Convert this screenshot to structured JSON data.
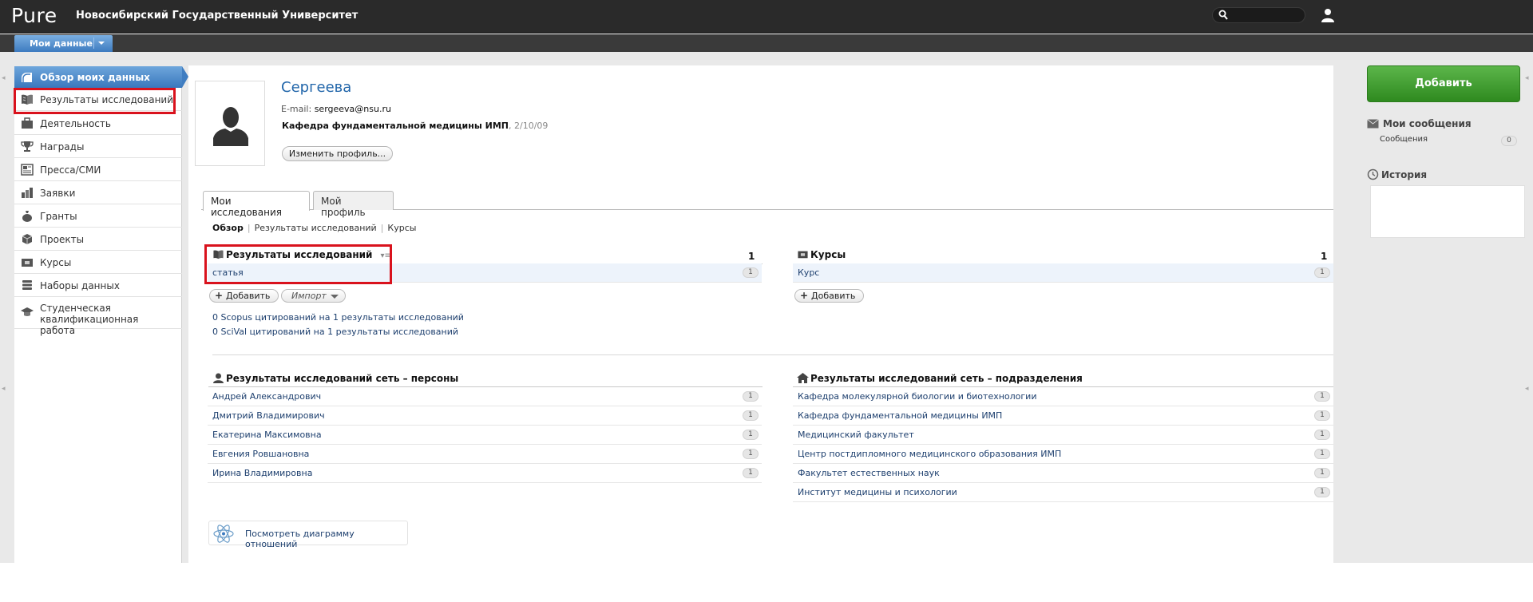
{
  "app": {
    "logo": "Pure",
    "university": "Новосибирский Государственный Университет",
    "search_placeholder": "",
    "nav_button": "Мои данные"
  },
  "sidebar": {
    "overview": "Обзор моих данных",
    "items": [
      {
        "label": "Результаты исследований",
        "icon": "book-icon"
      },
      {
        "label": "Деятельность",
        "icon": "briefcase-icon"
      },
      {
        "label": "Награды",
        "icon": "trophy-icon"
      },
      {
        "label": "Пресса/СМИ",
        "icon": "newspaper-icon"
      },
      {
        "label": "Заявки",
        "icon": "application-icon"
      },
      {
        "label": "Гранты",
        "icon": "money-bag-icon"
      },
      {
        "label": "Проекты",
        "icon": "cube-icon"
      },
      {
        "label": "Курсы",
        "icon": "course-icon"
      },
      {
        "label": "Наборы данных",
        "icon": "database-icon"
      },
      {
        "label": "Студенческая квалификационная работа",
        "icon": "graduation-cap-icon"
      }
    ]
  },
  "profile": {
    "name": "Сергеева",
    "email_label": "E-mail:",
    "email": "sergeeva@nsu.ru",
    "department": "Кафедра фундаментальной медицины ИМП",
    "date": ", 2/10/09",
    "edit_button": "Изменить профиль..."
  },
  "tabs": [
    "Мои исследования",
    "Мой профиль"
  ],
  "subnav": {
    "active": "Обзор",
    "links": [
      "Результаты исследований",
      "Курсы"
    ]
  },
  "research": {
    "title": "Результаты исследований",
    "count": "1",
    "rows": [
      {
        "label": "статья",
        "count": "1"
      }
    ],
    "add": "Добавить",
    "import": "Импорт",
    "cite1": "0 Scopus цитирований на 1 результаты исследований",
    "cite2": "0 SciVal цитирований на 1 результаты исследований"
  },
  "courses": {
    "title": "Курсы",
    "count": "1",
    "rows": [
      {
        "label": "Курс",
        "count": "1"
      }
    ],
    "add": "Добавить"
  },
  "network_persons": {
    "title": "Результаты исследований сеть – персоны",
    "rows": [
      {
        "label": "Андрей Александрович",
        "count": "1"
      },
      {
        "label": "Дмитрий Владимирович",
        "count": "1"
      },
      {
        "label": "Екатерина Максимовна",
        "count": "1"
      },
      {
        "label": "Евгения Ровшановна",
        "count": "1"
      },
      {
        "label": "Ирина Владимировна",
        "count": "1"
      }
    ]
  },
  "network_units": {
    "title": "Результаты исследований сеть – подразделения",
    "rows": [
      {
        "label": "Кафедра молекулярной биологии и биотехнологии",
        "count": "1"
      },
      {
        "label": "Кафедра фундаментальной медицины ИМП",
        "count": "1"
      },
      {
        "label": "Медицинский факультет",
        "count": "1"
      },
      {
        "label": "Центр постдипломного медицинского образования ИМП",
        "count": "1"
      },
      {
        "label": "Факультет естественных наук",
        "count": "1"
      },
      {
        "label": "Институт медицины и психологии",
        "count": "1"
      }
    ]
  },
  "diagram_button": "Посмотреть диаграмму отношений",
  "right": {
    "add_button": "Добавить",
    "messages_title": "Мои сообщения",
    "messages_label": "Сообщения",
    "messages_count": "0",
    "history_title": "История"
  },
  "colors": {
    "accent": "#3d7bc0",
    "highlight": "#d9121d",
    "add_green": "#3f9d2e",
    "link": "#1d3f6e"
  }
}
